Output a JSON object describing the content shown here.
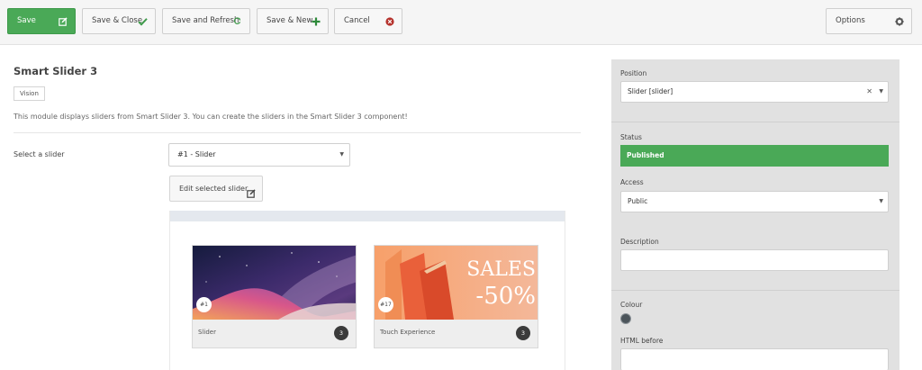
{
  "toolbar": {
    "save_label": "Save",
    "save_close_label": "Save & Close",
    "save_refresh_label": "Save and Refresh",
    "save_new_label": "Save & New",
    "cancel_label": "Cancel",
    "options_label": "Options"
  },
  "main": {
    "title": "Smart Slider 3",
    "badge": "Vision",
    "description": "This module displays sliders from Smart Slider 3. You can create the sliders in the Smart Slider 3 component!",
    "select_label": "Select a slider",
    "select_value": "#1 - Slider",
    "edit_button": "Edit selected slider",
    "cards": [
      {
        "number": "#1",
        "caption": "Slider",
        "count": "3"
      },
      {
        "number": "#17",
        "caption": "Touch Experience",
        "count": "3",
        "overlay_line1": "SALES",
        "overlay_line2": "-50%"
      }
    ]
  },
  "sidebar": {
    "position_label": "Position",
    "position_value": "Slider [slider]",
    "status_label": "Status",
    "status_value": "Published",
    "access_label": "Access",
    "access_value": "Public",
    "description_label": "Description",
    "description_value": "",
    "colour_label": "Colour",
    "html_before_label": "HTML before"
  },
  "colors": {
    "accent_green": "#4aa957",
    "panel_bg": "#e1e1e1",
    "colour_swatch": "#4c555b"
  }
}
